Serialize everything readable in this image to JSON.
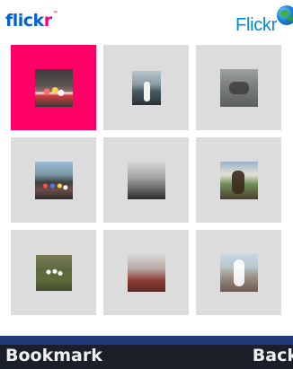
{
  "header": {
    "logo_text_left": "flick",
    "logo_text_right": "r",
    "logo_tm": "™",
    "app_title": "Flickr"
  },
  "grid": {
    "selected_index": 0,
    "items": [
      {
        "id": "photo-1"
      },
      {
        "id": "photo-2"
      },
      {
        "id": "photo-3"
      },
      {
        "id": "photo-4"
      },
      {
        "id": "photo-5"
      },
      {
        "id": "photo-6"
      },
      {
        "id": "photo-7"
      },
      {
        "id": "photo-8"
      },
      {
        "id": "photo-9"
      }
    ]
  },
  "softkeys": {
    "left": "Bookmark",
    "right": "Back"
  },
  "icons": {
    "globe": "globe-icon"
  },
  "colors": {
    "selection": "#ff0066",
    "logo_blue": "#0063dc",
    "logo_pink": "#ff0084",
    "title_blue": "#0088dd",
    "tile_bg": "#dcdcdc",
    "softkey_bg": "#1a1f2a"
  }
}
